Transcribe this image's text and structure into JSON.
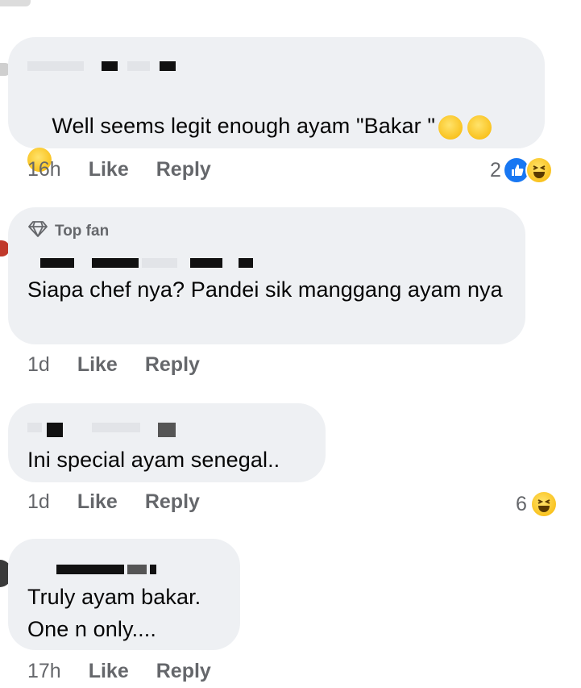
{
  "comments": [
    {
      "text": "Well seems legit enough ayam \"Bakar \"",
      "time": "16h",
      "like": "Like",
      "reply": "Reply",
      "reaction_count": "2",
      "reactions": [
        "like-icon",
        "laugh-icon"
      ],
      "inline_emojis": [
        "rolling-on-floor-laughing-icon",
        "rolling-on-floor-laughing-icon",
        "rolling-on-floor-laughing-icon"
      ]
    },
    {
      "badge": "Top fan",
      "badge_icon": "diamond-icon",
      "text": "Siapa chef nya? Pandei sik manggang ayam nya",
      "time": "1d",
      "like": "Like",
      "reply": "Reply"
    },
    {
      "text": "Ini special ayam senegal..",
      "time": "1d",
      "like": "Like",
      "reply": "Reply",
      "reaction_count": "6",
      "reactions": [
        "laugh-icon"
      ]
    },
    {
      "text": "Truly ayam bakar.\nOne n only....",
      "time": "17h",
      "like": "Like",
      "reply": "Reply"
    }
  ],
  "colors": {
    "bubble": "#eef0f3",
    "meta_text": "#65676b",
    "like_blue": "#1877f2",
    "emoji_yellow": "#f7b500"
  }
}
